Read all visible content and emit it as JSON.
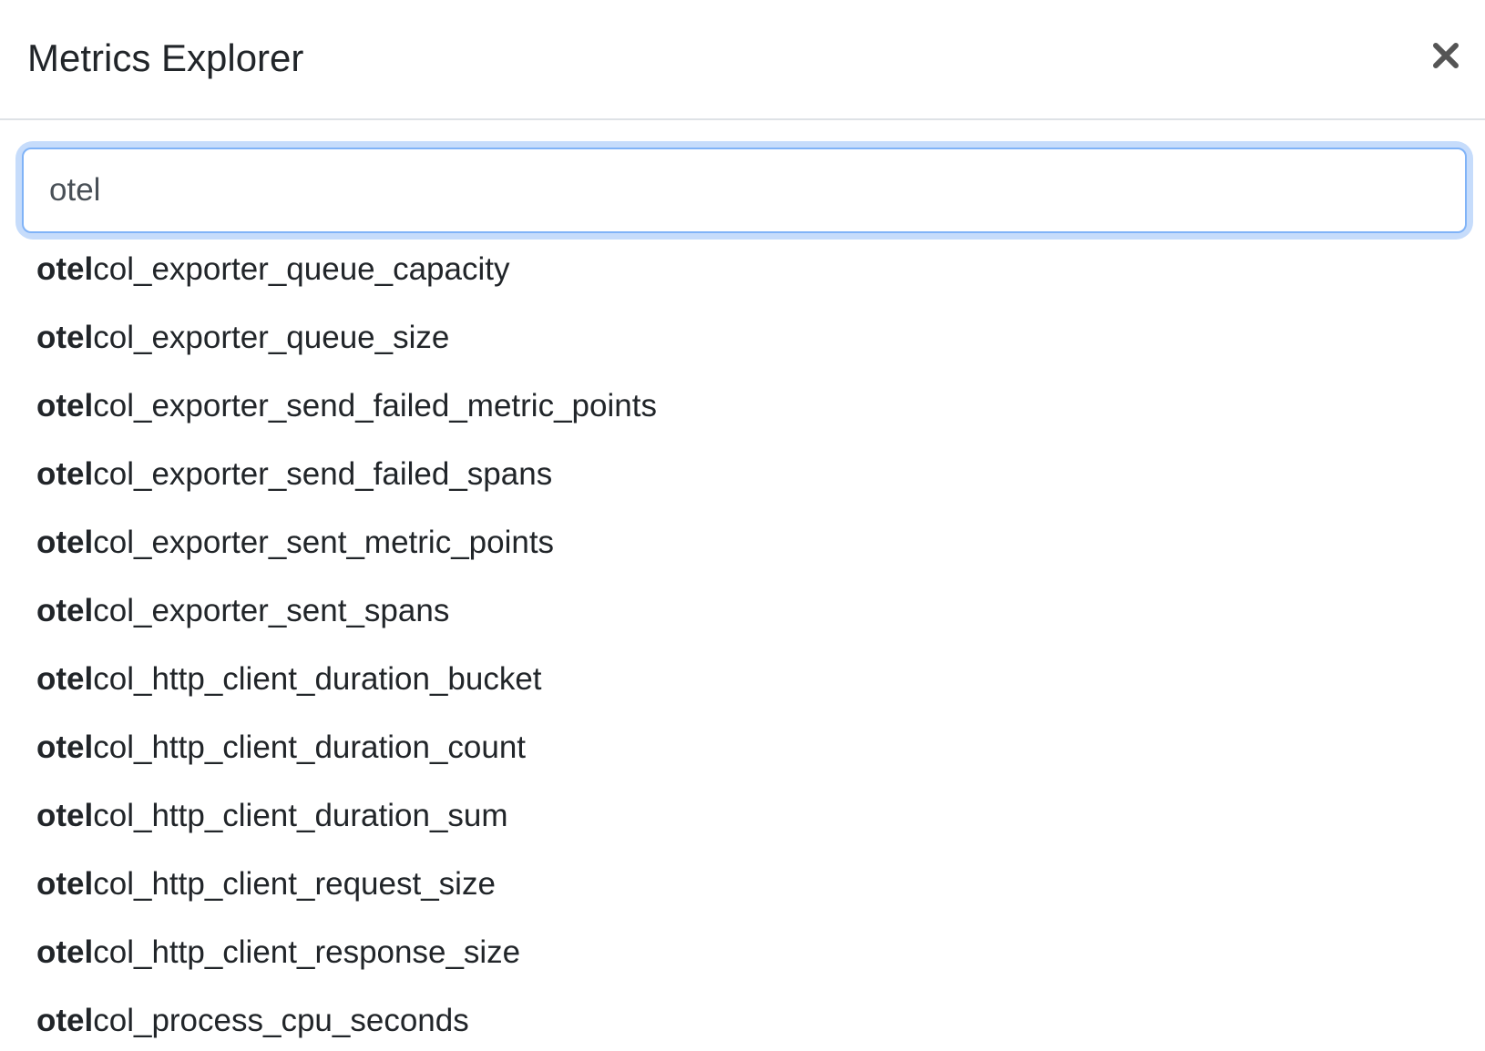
{
  "modal": {
    "title": "Metrics Explorer",
    "close_icon": "close-icon"
  },
  "search": {
    "value": "otel",
    "placeholder": ""
  },
  "results": [
    {
      "match": "otel",
      "rest": "col_exporter_queue_capacity"
    },
    {
      "match": "otel",
      "rest": "col_exporter_queue_size"
    },
    {
      "match": "otel",
      "rest": "col_exporter_send_failed_metric_points"
    },
    {
      "match": "otel",
      "rest": "col_exporter_send_failed_spans"
    },
    {
      "match": "otel",
      "rest": "col_exporter_sent_metric_points"
    },
    {
      "match": "otel",
      "rest": "col_exporter_sent_spans"
    },
    {
      "match": "otel",
      "rest": "col_http_client_duration_bucket"
    },
    {
      "match": "otel",
      "rest": "col_http_client_duration_count"
    },
    {
      "match": "otel",
      "rest": "col_http_client_duration_sum"
    },
    {
      "match": "otel",
      "rest": "col_http_client_request_size"
    },
    {
      "match": "otel",
      "rest": "col_http_client_response_size"
    },
    {
      "match": "otel",
      "rest": "col_process_cpu_seconds"
    }
  ],
  "colors": {
    "focus_ring": "#c6dcfb",
    "focus_border": "#80b3f7",
    "text": "#212529",
    "divider": "#dee2e6",
    "close": "#555555"
  }
}
